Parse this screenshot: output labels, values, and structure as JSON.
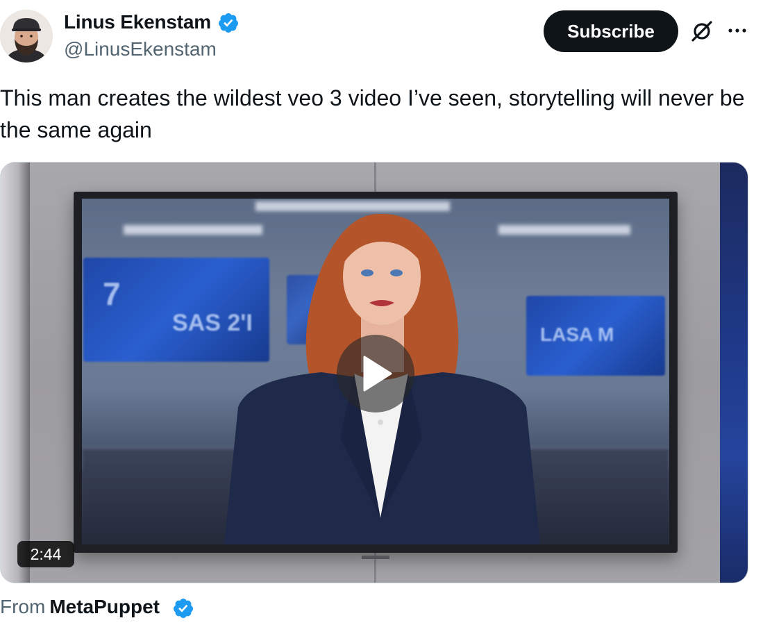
{
  "author": {
    "name": "Linus Ekenstam",
    "handle": "@LinusEkenstam",
    "verified": true,
    "avatar_icon": "avatar-photo"
  },
  "actions": {
    "subscribe_label": "Subscribe",
    "grok_icon": "grok-icon",
    "more_icon": "more-icon"
  },
  "post": {
    "text": "This man creates the wildest veo 3 video I’ve seen, storytelling will never be the same again"
  },
  "media": {
    "type": "video",
    "duration": "2:44",
    "play_icon": "play-icon",
    "screen_texts": {
      "left_monitor_top": "7",
      "left_monitor_main": "SAS 2'I",
      "right_monitor": "LASA M"
    }
  },
  "attribution": {
    "from_label": "From",
    "source_name": "MetaPuppet",
    "source_verified": true
  },
  "colors": {
    "verified_blue": "#1d9bf0",
    "subscribe_bg": "#0f1419",
    "secondary_text": "#536471",
    "primary_text": "#0f1419"
  }
}
